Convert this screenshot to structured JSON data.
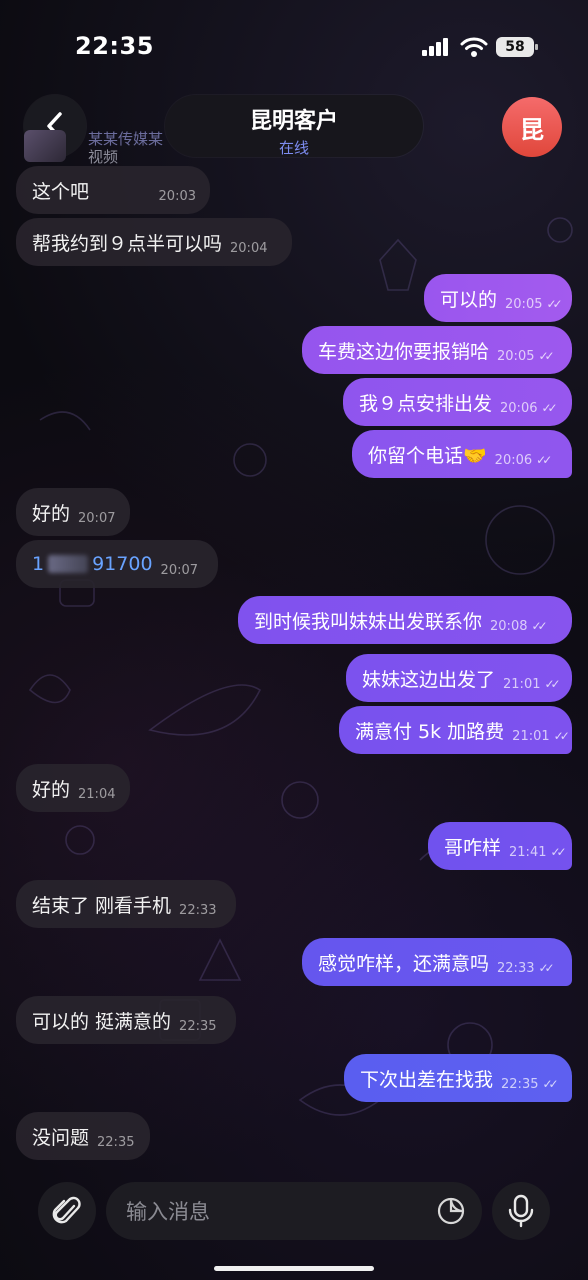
{
  "status_bar": {
    "time": "22:35",
    "battery": "58"
  },
  "header": {
    "contact_name": "昆明客户",
    "contact_status": "在线",
    "avatar_letter": "昆"
  },
  "quoted": {
    "name": "某某传媒某",
    "type": "视频"
  },
  "messages": [
    {
      "dir": "in",
      "text": "这个吧",
      "time": "20:03"
    },
    {
      "dir": "in",
      "text": "帮我约到９点半可以吗",
      "time": "20:04"
    },
    {
      "dir": "out",
      "text": "可以的",
      "time": "20:05"
    },
    {
      "dir": "out",
      "text": "车费这边你要报销哈",
      "time": "20:05"
    },
    {
      "dir": "out",
      "text": "我９点安排出发",
      "time": "20:06"
    },
    {
      "dir": "out",
      "text": "你留个电话🤝",
      "time": "20:06"
    },
    {
      "dir": "in",
      "text": "好的",
      "time": "20:07"
    },
    {
      "dir": "in",
      "text_prefix": "1",
      "text_suffix": "91700",
      "time": "20:07"
    },
    {
      "dir": "out",
      "text": "到时候我叫妹妹出发联系你",
      "time": "20:08"
    },
    {
      "dir": "out",
      "text": "妹妹这边出发了",
      "time": "21:01"
    },
    {
      "dir": "out",
      "text": "满意付 5k 加路费",
      "time": "21:01"
    },
    {
      "dir": "in",
      "text": "好的",
      "time": "21:04"
    },
    {
      "dir": "out",
      "text": "哥咋样",
      "time": "21:41"
    },
    {
      "dir": "in",
      "text": "结束了 刚看手机",
      "time": "22:33"
    },
    {
      "dir": "out",
      "text": "感觉咋样，还满意吗",
      "time": "22:33"
    },
    {
      "dir": "in",
      "text": "可以的 挺满意的",
      "time": "22:35"
    },
    {
      "dir": "out",
      "text": "下次出差在找我",
      "time": "22:35"
    },
    {
      "dir": "in",
      "text": "没问题",
      "time": "22:35"
    }
  ],
  "composer": {
    "placeholder": "输入消息"
  },
  "colors": {
    "accent": "#7d8cf0",
    "outgoing_top": "#a659f0",
    "outgoing_bottom": "#5b63f0",
    "incoming": "#28242c"
  }
}
